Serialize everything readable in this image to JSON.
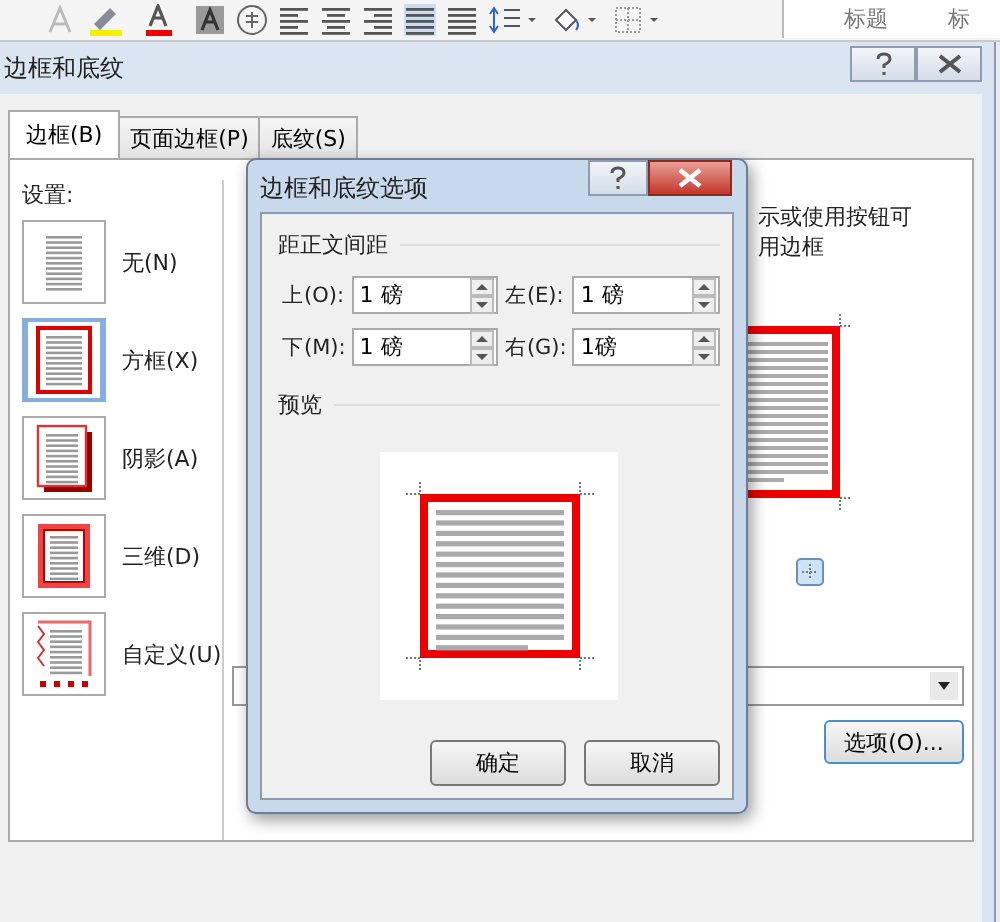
{
  "ribbon": {
    "style_gallery": [
      "标题",
      "标"
    ]
  },
  "window": {
    "title": "边框和底纹"
  },
  "tabs": [
    {
      "label": "边框(B)",
      "selected": true
    },
    {
      "label": "页面边框(P)",
      "selected": false
    },
    {
      "label": "底纹(S)",
      "selected": false
    }
  ],
  "settings": {
    "label": "设置:",
    "items": [
      {
        "label": "无(N)",
        "kind": "none",
        "selected": false
      },
      {
        "label": "方框(X)",
        "kind": "box",
        "selected": true
      },
      {
        "label": "阴影(A)",
        "kind": "shadow",
        "selected": false
      },
      {
        "label": "三维(D)",
        "kind": "threed",
        "selected": false
      },
      {
        "label": "自定义(U)",
        "kind": "custom",
        "selected": false
      }
    ]
  },
  "preview_hint": [
    "示或使用按钮可",
    "用边框"
  ],
  "options_button": "选项(O)...",
  "options_dialog": {
    "title": "边框和底纹选项",
    "margin_group": "距正文间距",
    "fields": [
      {
        "label": "上(O):",
        "value": "1 磅"
      },
      {
        "label": "左(E):",
        "value": "1 磅"
      },
      {
        "label": "下(M):",
        "value": "1 磅"
      },
      {
        "label": "右(G):",
        "value": "1磅"
      }
    ],
    "preview_label": "预览",
    "buttons": [
      "确定",
      "取消"
    ]
  }
}
